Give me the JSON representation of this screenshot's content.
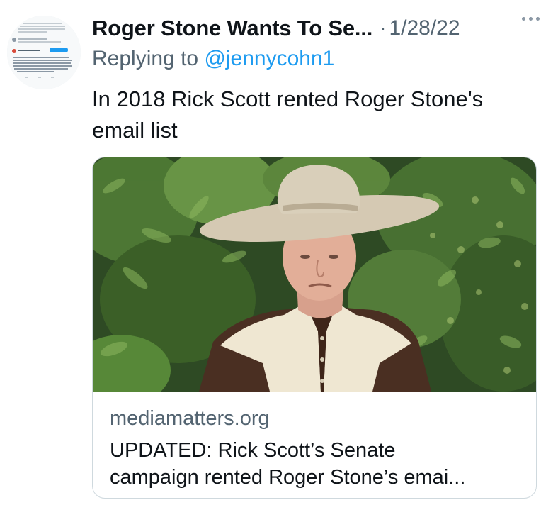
{
  "tweet": {
    "display_name": "Roger Stone Wants To Se...",
    "separator": "·",
    "date": "1/28/22",
    "reply_prefix": "Replying to",
    "reply_handle": "@jennycohn1",
    "text_line1": "In 2018 Rick Scott rented Roger Stone's",
    "text_line2": "email list",
    "more_icon": "more-horizontal-icon"
  },
  "link_card": {
    "domain": "mediamatters.org",
    "title_line1": "UPDATED: Rick Scott’s Senate",
    "title_line2": "campaign rented Roger Stone’s emai...",
    "image": "photo-man-in-cowboy-hat-western-shirt-foliage-background"
  },
  "colors": {
    "text_primary": "#0f1419",
    "text_secondary": "#536471",
    "link": "#1d9bf0",
    "border": "#cfd9de"
  }
}
